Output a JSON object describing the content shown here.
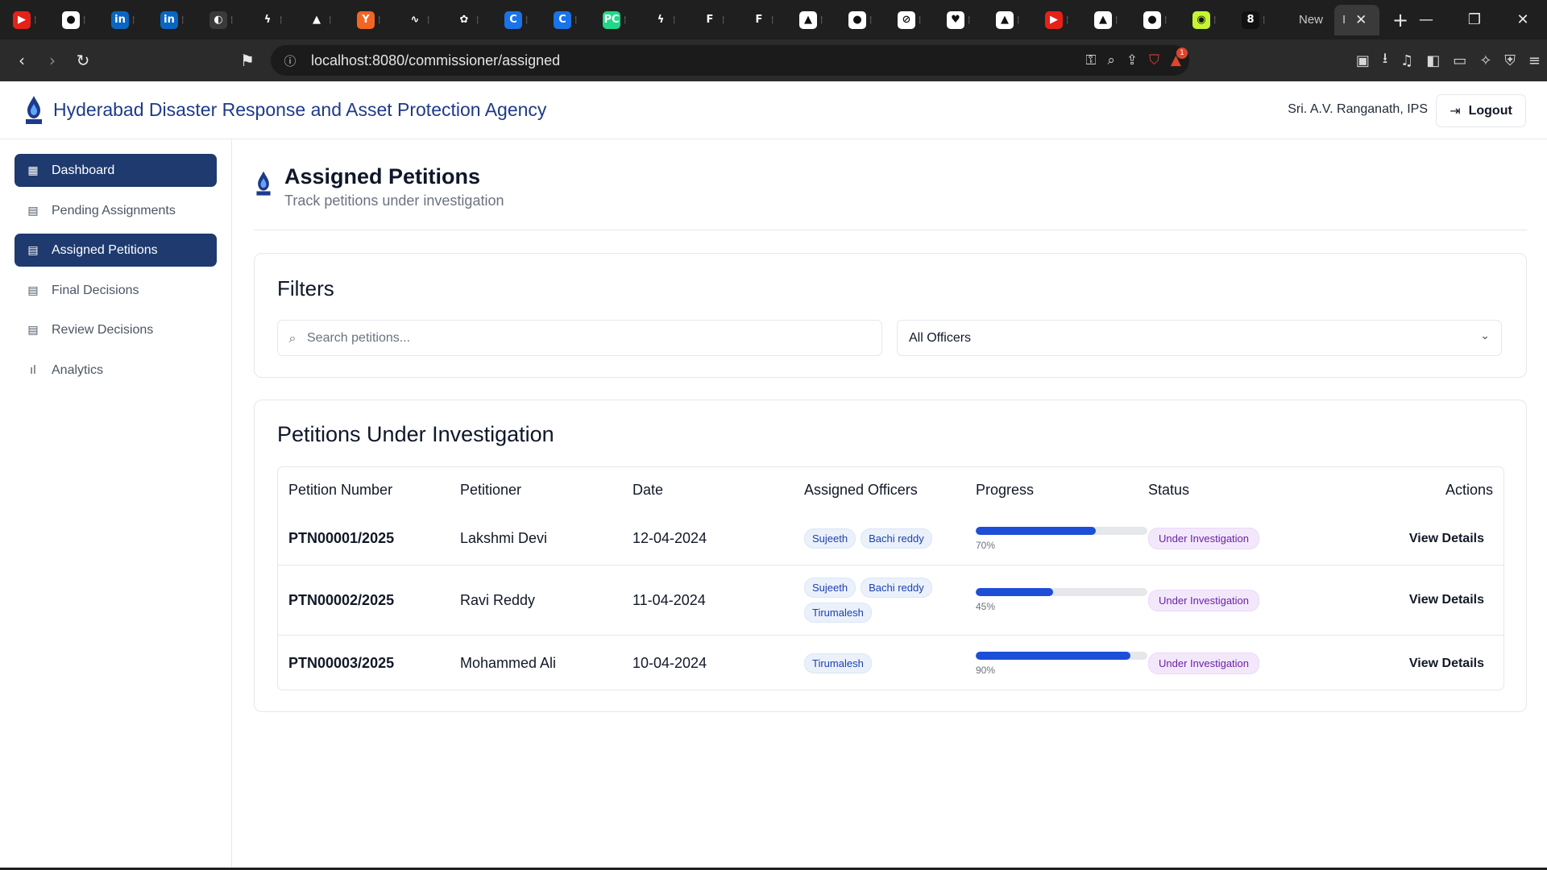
{
  "browser": {
    "tabs": [
      {
        "icon": "youtube-icon",
        "glyph": "▶",
        "bg": "#e62117"
      },
      {
        "icon": "github-icon",
        "glyph": "●",
        "bg": "#ffffff"
      },
      {
        "icon": "linkedin-icon",
        "glyph": "in",
        "bg": "#0a66c2"
      },
      {
        "icon": "linkedin-icon",
        "glyph": "in",
        "bg": "#0a66c2"
      },
      {
        "icon": "perplexity-icon",
        "glyph": "◐",
        "bg": "#3a3a3a"
      },
      {
        "icon": "bolt-icon",
        "glyph": "ϟ",
        "bg": "#1f1f1f"
      },
      {
        "icon": "drive-icon",
        "glyph": "▲",
        "bg": "#1f1f1f"
      },
      {
        "icon": "ycombinator-icon",
        "glyph": "Y",
        "bg": "#f26522"
      },
      {
        "icon": "swirl-icon",
        "glyph": "∿",
        "bg": "#1f1f1f"
      },
      {
        "icon": "openai-icon",
        "glyph": "✿",
        "bg": "#1f1f1f"
      },
      {
        "icon": "c-icon",
        "glyph": "C",
        "bg": "#1a73e8"
      },
      {
        "icon": "c-icon",
        "glyph": "C",
        "bg": "#1a73e8"
      },
      {
        "icon": "pycharm-icon",
        "glyph": "PC",
        "bg": "#21d789"
      },
      {
        "icon": "bolt-icon",
        "glyph": "ϟ",
        "bg": "#1f1f1f"
      },
      {
        "icon": "framer-icon",
        "glyph": "F",
        "bg": "#1f1f1f"
      },
      {
        "icon": "framer-icon",
        "glyph": "F",
        "bg": "#1f1f1f"
      },
      {
        "icon": "vercel-icon",
        "glyph": "▲",
        "bg": "#ffffff"
      },
      {
        "icon": "github-icon",
        "glyph": "●",
        "bg": "#ffffff"
      },
      {
        "icon": "grok-icon",
        "glyph": "⊘",
        "bg": "#ffffff"
      },
      {
        "icon": "heart-icon",
        "glyph": "♥",
        "bg": "#ffffff"
      },
      {
        "icon": "vercel-icon",
        "glyph": "▲",
        "bg": "#ffffff"
      },
      {
        "icon": "youtube-icon",
        "glyph": "▶",
        "bg": "#e62117"
      },
      {
        "icon": "vercel-icon",
        "glyph": "▲",
        "bg": "#ffffff"
      },
      {
        "icon": "github-icon",
        "glyph": "●",
        "bg": "#ffffff"
      },
      {
        "icon": "greenlight-icon",
        "glyph": "◉",
        "bg": "#c6f432"
      },
      {
        "icon": "8-icon",
        "glyph": "8",
        "bg": "#111111"
      }
    ],
    "new_tab_label": "New",
    "active_tab_glyph": "I",
    "url": "localhost:8080/commissioner/assigned",
    "brave_count": "1"
  },
  "header": {
    "agency": "Hyderabad Disaster Response and Asset Protection Agency",
    "user": "Sri. A.V. Ranganath, IPS",
    "logout": "Logout"
  },
  "sidebar": {
    "items": [
      {
        "label": "Dashboard",
        "icon": "grid-icon",
        "glyph": "▦"
      },
      {
        "label": "Pending Assignments",
        "icon": "document-icon",
        "glyph": "▤"
      },
      {
        "label": "Assigned Petitions",
        "icon": "document-icon",
        "glyph": "▤"
      },
      {
        "label": "Final Decisions",
        "icon": "document-icon",
        "glyph": "▤"
      },
      {
        "label": "Review Decisions",
        "icon": "document-icon",
        "glyph": "▤"
      },
      {
        "label": "Analytics",
        "icon": "bar-chart-icon",
        "glyph": "ıl"
      }
    ]
  },
  "page": {
    "title": "Assigned Petitions",
    "subtitle": "Track petitions under investigation"
  },
  "filters": {
    "title": "Filters",
    "search_placeholder": "Search petitions...",
    "officer_select": "All Officers"
  },
  "table": {
    "title": "Petitions Under Investigation",
    "columns": [
      "Petition Number",
      "Petitioner",
      "Date",
      "Assigned Officers",
      "Progress",
      "Status",
      "Actions"
    ],
    "rows": [
      {
        "number": "PTN00001/2025",
        "petitioner": "Lakshmi Devi",
        "date": "12-04-2024",
        "officers": [
          "Sujeeth",
          "Bachi reddy"
        ],
        "progress": 70,
        "progress_label": "70%",
        "status": "Under Investigation",
        "action": "View Details"
      },
      {
        "number": "PTN00002/2025",
        "petitioner": "Ravi Reddy",
        "date": "11-04-2024",
        "officers": [
          "Sujeeth",
          "Bachi reddy",
          "Tirumalesh"
        ],
        "progress": 45,
        "progress_label": "45%",
        "status": "Under Investigation",
        "action": "View Details"
      },
      {
        "number": "PTN00003/2025",
        "petitioner": "Mohammed Ali",
        "date": "10-04-2024",
        "officers": [
          "Tirumalesh"
        ],
        "progress": 90,
        "progress_label": "90%",
        "status": "Under Investigation",
        "action": "View Details"
      }
    ]
  },
  "colors": {
    "brand": "#1e3a6e",
    "agency_text": "#1e3a8a",
    "progress": "#1d4ed8",
    "chip_bg": "#eaf1fb",
    "badge_bg": "#f3e8fb"
  }
}
